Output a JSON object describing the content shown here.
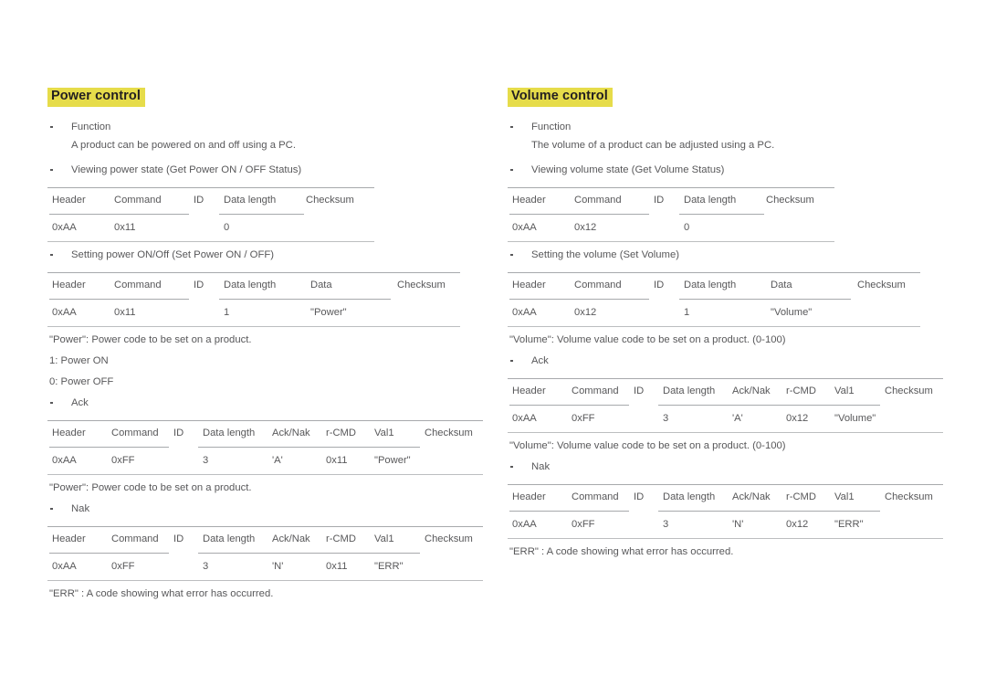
{
  "document": {
    "columns": [
      {
        "id": "power-control",
        "title": "Power control",
        "blocks": [
          {
            "kind": "bullet",
            "text": "Function",
            "sub": "A product can be powered on and off using a PC."
          },
          {
            "kind": "bullet",
            "text": "Viewing power state (Get Power ON / OFF Status)"
          },
          {
            "kind": "table",
            "id": "get-power-status-table",
            "layout": "five",
            "headers": [
              "Header",
              "Command",
              "ID",
              "Data length",
              "Checksum"
            ],
            "values": [
              "0xAA",
              "0x11",
              "",
              "0",
              ""
            ]
          },
          {
            "kind": "bullet",
            "text": "Setting power ON/Off (Set Power ON / OFF)"
          },
          {
            "kind": "table",
            "id": "set-power-table",
            "layout": "six",
            "headers": [
              "Header",
              "Command",
              "ID",
              "Data length",
              "Data",
              "Checksum"
            ],
            "values": [
              "0xAA",
              "0x11",
              "",
              "1",
              "\"Power\"",
              ""
            ]
          },
          {
            "kind": "note",
            "text": "\"Power\": Power code to be set on a product."
          },
          {
            "kind": "plain",
            "text": "1: Power ON"
          },
          {
            "kind": "plain",
            "text": "0: Power OFF"
          },
          {
            "kind": "bullet",
            "text": "Ack"
          },
          {
            "kind": "table",
            "id": "power-ack-table",
            "layout": "eight",
            "headers": [
              "Header",
              "Command",
              "ID",
              "Data length",
              "Ack/Nak",
              "r-CMD",
              "Val1",
              "Checksum"
            ],
            "values": [
              "0xAA",
              "0xFF",
              "",
              "3",
              "'A'",
              "0x11",
              "\"Power\"",
              ""
            ]
          },
          {
            "kind": "note",
            "text": "\"Power\": Power code to be set on a product."
          },
          {
            "kind": "bullet",
            "text": "Nak"
          },
          {
            "kind": "table",
            "id": "power-nak-table",
            "layout": "eight",
            "headers": [
              "Header",
              "Command",
              "ID",
              "Data length",
              "Ack/Nak",
              "r-CMD",
              "Val1",
              "Checksum"
            ],
            "values": [
              "0xAA",
              "0xFF",
              "",
              "3",
              "'N'",
              "0x11",
              "\"ERR\"",
              ""
            ]
          },
          {
            "kind": "note",
            "text": "\"ERR\" : A code showing what error has occurred."
          }
        ]
      },
      {
        "id": "volume-control",
        "title": "Volume control",
        "blocks": [
          {
            "kind": "bullet",
            "text": "Function",
            "sub": "The volume of a product can be adjusted using a PC."
          },
          {
            "kind": "bullet",
            "text": "Viewing volume state (Get Volume Status)"
          },
          {
            "kind": "table",
            "id": "get-volume-status-table",
            "layout": "five",
            "headers": [
              "Header",
              "Command",
              "ID",
              "Data length",
              "Checksum"
            ],
            "values": [
              "0xAA",
              "0x12",
              "",
              "0",
              ""
            ]
          },
          {
            "kind": "bullet",
            "text": "Setting the volume (Set Volume)"
          },
          {
            "kind": "table",
            "id": "set-volume-table",
            "layout": "six",
            "headers": [
              "Header",
              "Command",
              "ID",
              "Data length",
              "Data",
              "Checksum"
            ],
            "values": [
              "0xAA",
              "0x12",
              "",
              "1",
              "\"Volume\"",
              ""
            ]
          },
          {
            "kind": "note",
            "text": "\"Volume\": Volume value code to be set on a product. (0-100)"
          },
          {
            "kind": "bullet",
            "text": "Ack"
          },
          {
            "kind": "table",
            "id": "volume-ack-table",
            "layout": "eight",
            "headers": [
              "Header",
              "Command",
              "ID",
              "Data length",
              "Ack/Nak",
              "r-CMD",
              "Val1",
              "Checksum"
            ],
            "values": [
              "0xAA",
              "0xFF",
              "",
              "3",
              "'A'",
              "0x12",
              "\"Volume\"",
              ""
            ]
          },
          {
            "kind": "note",
            "text": "\"Volume\": Volume value code to be set on a product. (0-100)"
          },
          {
            "kind": "bullet",
            "text": "Nak"
          },
          {
            "kind": "table",
            "id": "volume-nak-table",
            "layout": "eight",
            "headers": [
              "Header",
              "Command",
              "ID",
              "Data length",
              "Ack/Nak",
              "r-CMD",
              "Val1",
              "Checksum"
            ],
            "values": [
              "0xAA",
              "0xFF",
              "",
              "3",
              "'N'",
              "0x12",
              "\"ERR\"",
              ""
            ]
          },
          {
            "kind": "note",
            "text": "\"ERR\" : A code showing what error has occurred."
          }
        ]
      }
    ],
    "colors": {
      "highlight": "#e6dc4a",
      "title_text": "#231f20",
      "body_text": "#58585a",
      "rule": "#a7a9ac"
    }
  }
}
